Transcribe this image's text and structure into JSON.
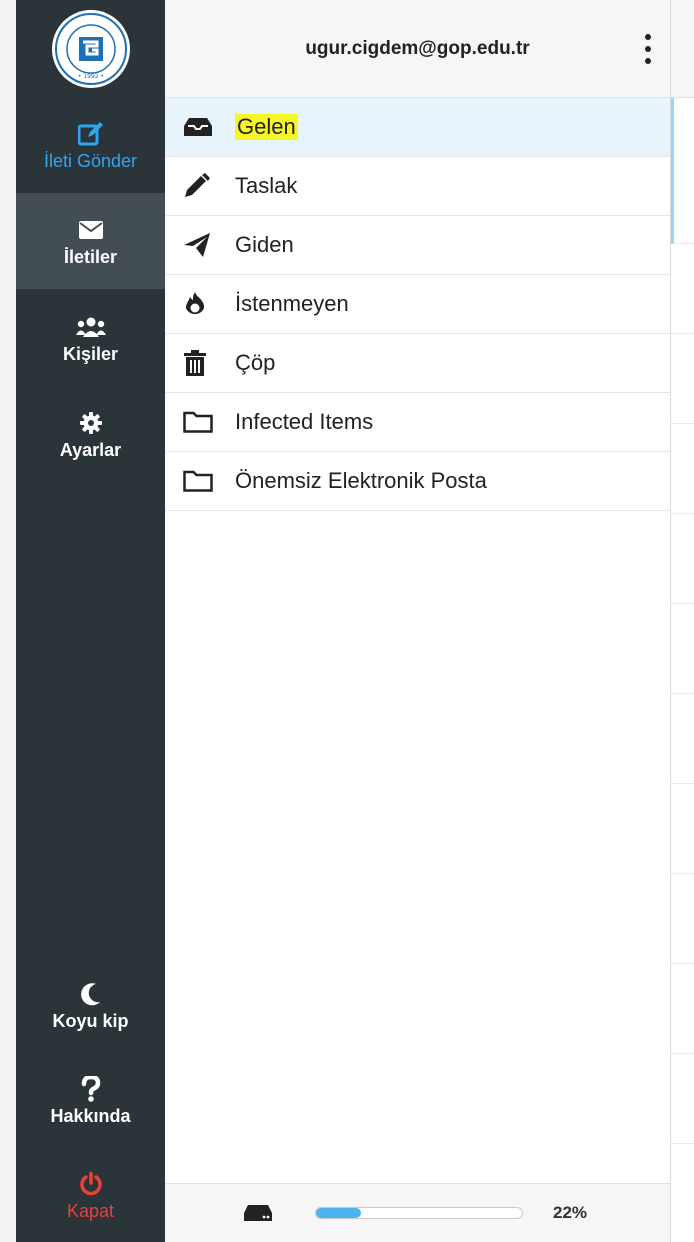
{
  "app": {
    "account_email": "ugur.cigdem@gop.edu.tr",
    "logo": "university-seal-logo"
  },
  "nav": {
    "compose": {
      "label": "İleti Gönder",
      "icon": "compose-icon"
    },
    "messages": {
      "label": "İletiler",
      "icon": "envelope-icon"
    },
    "contacts": {
      "label": "Kişiler",
      "icon": "users-icon"
    },
    "settings": {
      "label": "Ayarlar",
      "icon": "gear-icon"
    },
    "darkmode": {
      "label": "Koyu kip",
      "icon": "moon-icon"
    },
    "about": {
      "label": "Hakkında",
      "icon": "question-icon"
    },
    "logout": {
      "label": "Kapat",
      "icon": "power-icon"
    }
  },
  "folders": [
    {
      "label": "Gelen",
      "icon": "inbox-icon",
      "selected": true,
      "highlighted": true
    },
    {
      "label": "Taslak",
      "icon": "pencil-icon"
    },
    {
      "label": "Giden",
      "icon": "paper-plane-icon"
    },
    {
      "label": "İstenmeyen",
      "icon": "fire-icon"
    },
    {
      "label": "Çöp",
      "icon": "trash-icon"
    },
    {
      "label": "Infected Items",
      "icon": "folder-icon"
    },
    {
      "label": "Önemsiz Elektronik Posta",
      "icon": "folder-icon"
    }
  ],
  "quota": {
    "percent_label": "22%",
    "percent": 22,
    "icon": "hard-drive-icon"
  },
  "colors": {
    "nav_bg": "#2b3439",
    "nav_active": "#434e54",
    "accent": "#2ea6f2",
    "logout": "#e8413c",
    "selected_folder_bg": "#e8f4fb",
    "highlight": "#f5f527"
  }
}
